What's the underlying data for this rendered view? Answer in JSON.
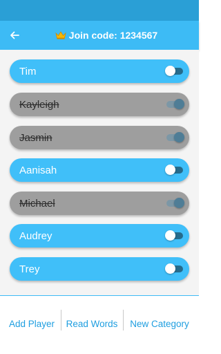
{
  "header": {
    "title": "Join code: 1234567",
    "back_icon": "arrow-left-icon",
    "crown_icon": "crown-icon",
    "colors": {
      "status_bar": "#2a9fd6",
      "app_bar": "#3dbbf5"
    }
  },
  "players": [
    {
      "name": "Tim",
      "active": true
    },
    {
      "name": "Kayleigh",
      "active": false
    },
    {
      "name": "Jasmin",
      "active": false
    },
    {
      "name": "Aanisah",
      "active": true
    },
    {
      "name": "Michael",
      "active": false
    },
    {
      "name": "Audrey",
      "active": true
    },
    {
      "name": "Trey",
      "active": true
    }
  ],
  "bottom_bar": {
    "add_player": "Add Player",
    "read_words": "Read Words",
    "new_category": "New Category"
  },
  "colors": {
    "active_pill": "#40bff9",
    "inactive_pill": "#9e9e9e",
    "accent_text": "#1e9ee0"
  }
}
